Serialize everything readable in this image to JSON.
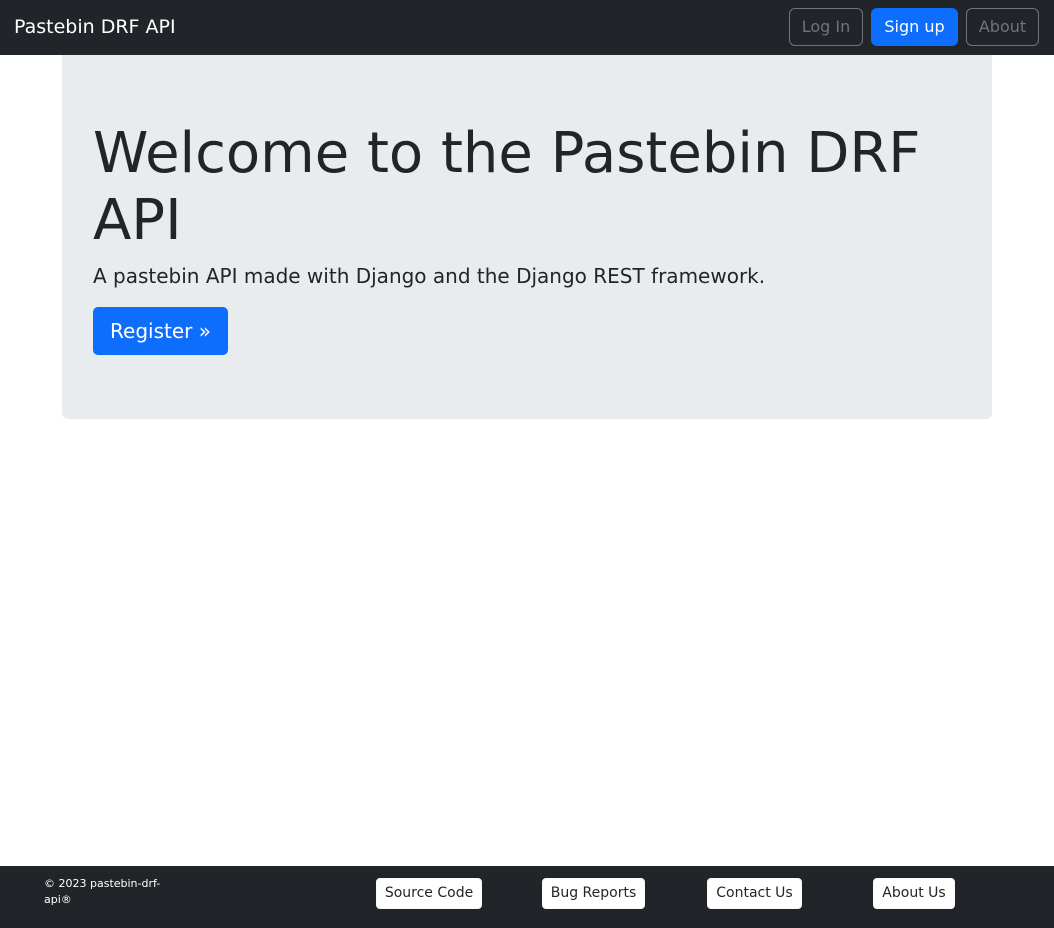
{
  "navbar": {
    "brand": "Pastebin DRF API",
    "login_label": "Log In",
    "signup_label": "Sign up",
    "about_label": "About"
  },
  "hero": {
    "title": "Welcome to the Pastebin DRF API",
    "subtitle": "A pastebin API made with Django and the Django REST framework.",
    "register_label": "Register »"
  },
  "footer": {
    "copyright": "© 2023 pastebin-drf-api®",
    "links": [
      {
        "label": "Source Code"
      },
      {
        "label": "Bug Reports"
      },
      {
        "label": "Contact Us"
      },
      {
        "label": "About Us"
      }
    ]
  },
  "colors": {
    "navbar_bg": "#212529",
    "primary": "#0d6efd",
    "secondary": "#6c757d",
    "jumbotron_bg": "#e9ecef"
  }
}
